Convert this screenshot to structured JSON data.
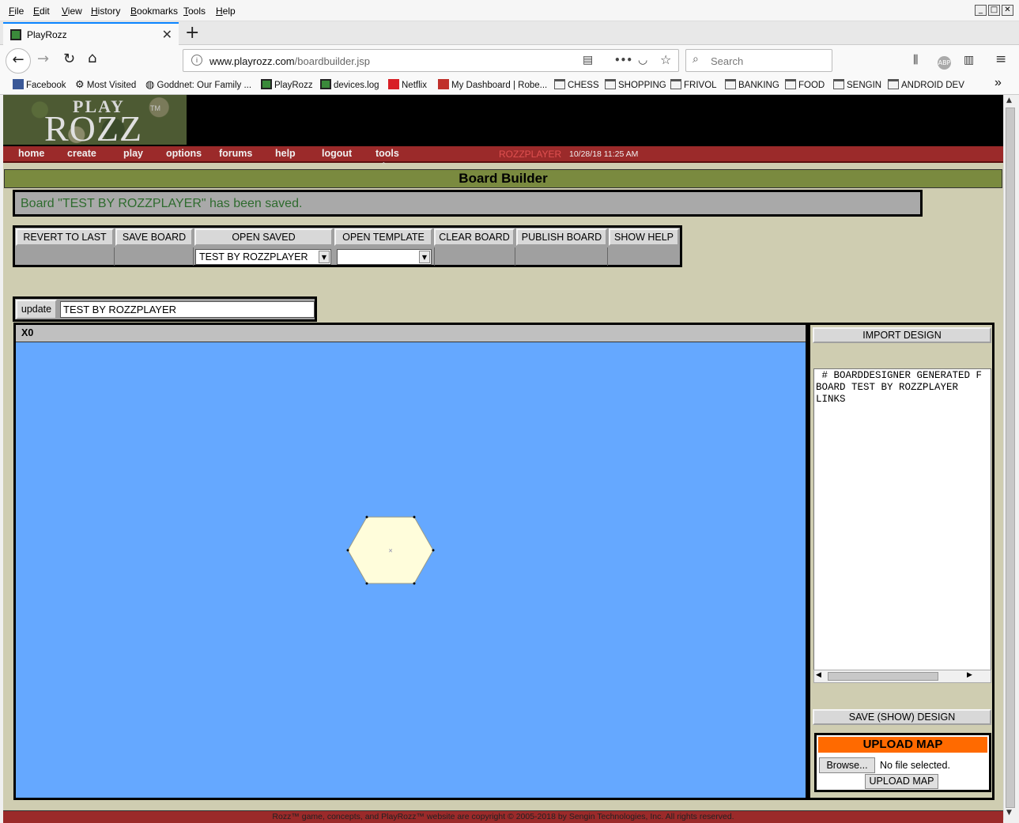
{
  "menubar": {
    "items": [
      "File",
      "Edit",
      "View",
      "History",
      "Bookmarks",
      "Tools",
      "Help"
    ],
    "window_controls": [
      "_",
      "□",
      "✕"
    ]
  },
  "tab": {
    "title": "PlayRozz",
    "close": "✕",
    "new_tab": "+"
  },
  "nav": {
    "back": "←",
    "forward": "→",
    "reload": "↻",
    "home": "⌂",
    "url_domain": "www.playrozz.com",
    "url_path": "/boardbuilder.jsp",
    "url_info": "i",
    "reader_icon": "▤",
    "more_icon": "•••",
    "pocket_icon": "◡",
    "star_icon": "☆",
    "search_icon": "⌕",
    "search_placeholder": "Search",
    "library_icon": "⫼",
    "abp_icon": "ABP",
    "sidebar_icon": "▥",
    "menu_icon": "≡"
  },
  "bookmarks": [
    {
      "label": "Facebook",
      "icon": "fb"
    },
    {
      "label": "Most Visited",
      "icon": "gear"
    },
    {
      "label": "Goddnet: Our Family ...",
      "icon": "globe"
    },
    {
      "label": "PlayRozz",
      "icon": "pr"
    },
    {
      "label": "devices.log",
      "icon": "pr"
    },
    {
      "label": "Netflix",
      "icon": "nf"
    },
    {
      "label": "My Dashboard | Robe...",
      "icon": "rh"
    },
    {
      "label": "CHESS",
      "icon": "folder"
    },
    {
      "label": "SHOPPING",
      "icon": "folder"
    },
    {
      "label": "FRIVOL",
      "icon": "folder"
    },
    {
      "label": "BANKING",
      "icon": "folder"
    },
    {
      "label": "FOOD",
      "icon": "folder"
    },
    {
      "label": "SENGIN",
      "icon": "folder"
    },
    {
      "label": "ANDROID DEV",
      "icon": "folder"
    }
  ],
  "bookmarks_overflow": "»",
  "logo": {
    "play": "PLAY",
    "rozz": "ROZZ",
    "tm": "TM"
  },
  "site_nav": {
    "items": [
      "home",
      "create",
      "play",
      "options",
      "forums",
      "help",
      "logout",
      "tools"
    ],
    "user": "ROZZPLAYER",
    "datetime": "10/28/18 11:25 AM",
    "caret": "^"
  },
  "page_title": "Board Builder",
  "message": "Board \"TEST BY ROZZPLAYER\" has been saved.",
  "toolbar": {
    "revert": "REVERT TO LAST",
    "save_board": "SAVE BOARD",
    "open_saved": "OPEN SAVED",
    "open_template": "OPEN TEMPLATE",
    "clear_board": "CLEAR BOARD",
    "publish_board": "PUBLISH BOARD",
    "show_help": "SHOW HELP",
    "open_saved_value": "TEST BY ROZZPLAYER",
    "open_template_value": "",
    "select_arrow": "▼"
  },
  "update": {
    "button": "update",
    "value": "TEST BY ROZZPLAYER"
  },
  "board": {
    "header": "X0"
  },
  "right_panel": {
    "import": "IMPORT DESIGN",
    "design_text": " # BOARDDESIGNER GENERATED F\nBOARD TEST BY ROZZPLAYER\nLINKS",
    "hscroll_left": "◀",
    "hscroll_right": "▶",
    "save_design": "SAVE (SHOW) DESIGN",
    "upload_title": "UPLOAD MAP",
    "browse": "Browse...",
    "no_file": "No file selected.",
    "upload_button": "UPLOAD MAP"
  },
  "footer": "Rozz™ game, concepts, and PlayRozz™ website are copyright © 2005-2018 by Sengin Technologies, Inc. All rights reserved.",
  "scrollbar": {
    "up": "▲",
    "down": "▼"
  },
  "colors": {
    "page_bg": "#cfcdb1",
    "board_bg": "#65a8ff",
    "hex_fill": "#fffddb",
    "nav_strip": "#9b2a2a",
    "title_bar": "#7a8a3f",
    "upload_title": "#ff6a00",
    "message_text": "#2e6b2e"
  }
}
